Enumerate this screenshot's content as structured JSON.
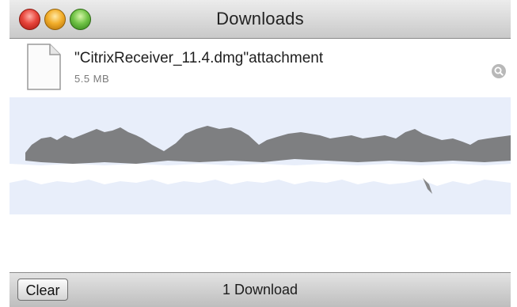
{
  "window": {
    "title": "Downloads",
    "controls": [
      "close",
      "minimize",
      "zoom"
    ]
  },
  "downloads": {
    "items": [
      {
        "name": "\"CitrixReceiver_11.4.dmg\"attachment",
        "size": "5.5 MB",
        "icon": "document-icon",
        "action_icon": "magnifier-icon"
      }
    ]
  },
  "footer": {
    "clear_label": "Clear",
    "count_label": "1 Download"
  },
  "colors": {
    "selection_band": "#e8eefa",
    "close": "#e8463c",
    "minimize": "#f2ae2b",
    "zoom": "#72c447"
  }
}
